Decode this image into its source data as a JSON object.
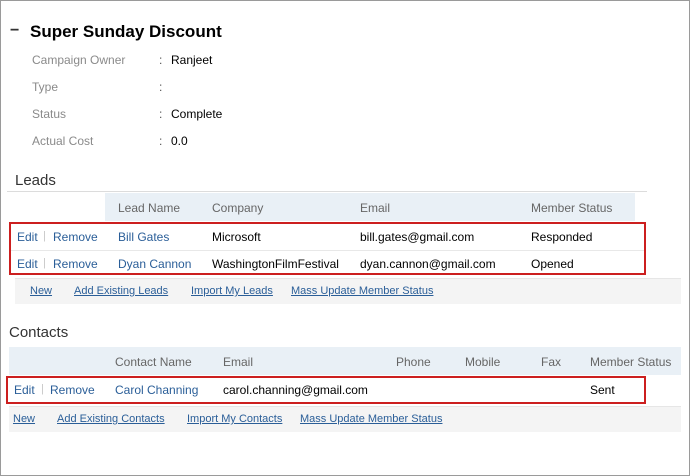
{
  "campaign": {
    "toggle": "−",
    "title": "Super Sunday Discount",
    "details": [
      {
        "label": "Campaign Owner",
        "separator": ":",
        "value": "Ranjeet"
      },
      {
        "label": "Type",
        "separator": ":",
        "value": ""
      },
      {
        "label": "Status",
        "separator": ":",
        "value": "Complete"
      },
      {
        "label": "Actual Cost",
        "separator": ":",
        "value": "0.0"
      }
    ]
  },
  "leads": {
    "heading": "Leads",
    "columns": {
      "lead_name": "Lead Name",
      "company": "Company",
      "email": "Email",
      "member_status": "Member Status"
    },
    "rows": [
      {
        "edit": "Edit",
        "pipe": "|",
        "remove": "Remove",
        "name": "Bill Gates",
        "company": "Microsoft",
        "email": "bill.gates@gmail.com",
        "member_status": "Responded"
      },
      {
        "edit": "Edit",
        "pipe": "|",
        "remove": "Remove",
        "name": "Dyan Cannon",
        "company": "WashingtonFilmFestival",
        "email": "dyan.cannon@gmail.com",
        "member_status": "Opened"
      }
    ],
    "actions": {
      "new": "New",
      "add_existing": "Add Existing Leads",
      "import": "Import My Leads",
      "mass_update": "Mass Update Member Status"
    }
  },
  "contacts": {
    "heading": "Contacts",
    "columns": {
      "contact_name": "Contact Name",
      "email": "Email",
      "phone": "Phone",
      "mobile": "Mobile",
      "fax": "Fax",
      "member_status": "Member Status"
    },
    "rows": [
      {
        "edit": "Edit",
        "pipe": "|",
        "remove": "Remove",
        "name": "Carol Channing",
        "email": "carol.channing@gmail.com",
        "phone": "",
        "mobile": "",
        "fax": "",
        "member_status": "Sent"
      }
    ],
    "actions": {
      "new": "New",
      "add_existing": "Add Existing Contacts",
      "import": "Import My Contacts",
      "mass_update": "Mass Update Member Status"
    }
  }
}
